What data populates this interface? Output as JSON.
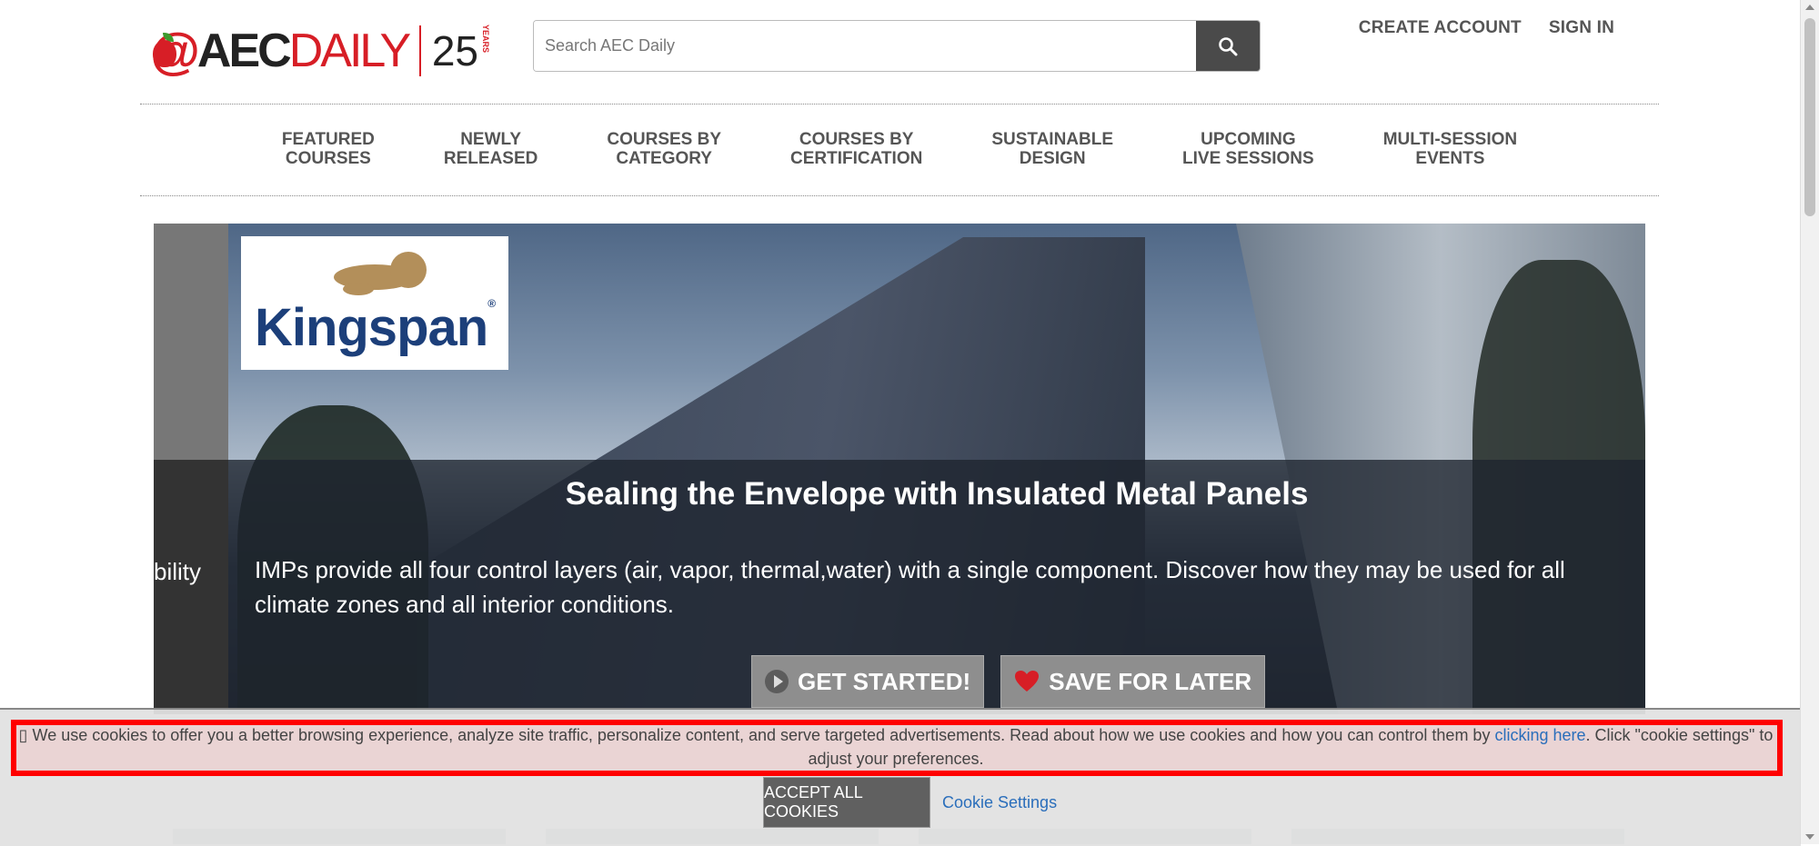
{
  "logo": {
    "brand_at": "@",
    "brand_aec": "AEC",
    "brand_daily": "DAILY",
    "anniversary": "25",
    "anniversary_sub": "YEARS"
  },
  "search": {
    "placeholder": "Search AEC Daily",
    "icon": "search-icon"
  },
  "topnav": {
    "create_account": "CREATE ACCOUNT",
    "sign_in": "SIGN IN"
  },
  "mainnav": [
    {
      "line1": "FEATURED",
      "line2": "COURSES"
    },
    {
      "line1": "NEWLY",
      "line2": "RELEASED"
    },
    {
      "line1": "COURSES BY",
      "line2": "CATEGORY"
    },
    {
      "line1": "COURSES BY",
      "line2": "CERTIFICATION"
    },
    {
      "line1": "SUSTAINABLE",
      "line2": "DESIGN"
    },
    {
      "line1": "UPCOMING",
      "line2": "LIVE SESSIONS"
    },
    {
      "line1": "MULTI-SESSION",
      "line2": "EVENTS"
    }
  ],
  "hero": {
    "sponsor": "Kingspan",
    "sponsor_mark": "®",
    "side_text": "bility",
    "title": "Sealing the Envelope with Insulated Metal Panels",
    "description": "IMPs provide all four control layers (air, vapor, thermal,water) with a single component. Discover how they may be used for all climate zones and all interior conditions.",
    "get_started": "GET STARTED!",
    "save_for_later": "SAVE FOR LATER"
  },
  "cookie": {
    "icon": "cookie-icon",
    "text_before": "We use cookies to offer you a better browsing experience, analyze site traffic, personalize content, and serve targeted advertisements. Read about how we use cookies and how you can control them by ",
    "link": "clicking here",
    "text_after": ". Click \"cookie settings\" to adjust your preferences.",
    "accept": "ACCEPT ALL COOKIES",
    "settings": "Cookie Settings",
    "highlight_color": "#ff0000"
  },
  "colors": {
    "brand_red": "#d71e26",
    "link_blue": "#2a6ebb",
    "kingspan_blue": "#1c3f7a"
  }
}
